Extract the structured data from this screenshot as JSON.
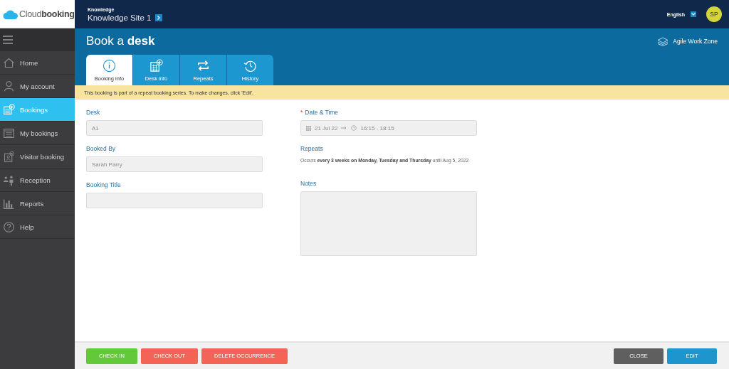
{
  "logo": {
    "light": "Cloud",
    "bold": "booking"
  },
  "header": {
    "site_label": "Knowledge",
    "site_name": "Knowledge Site 1",
    "language": "English",
    "avatar": "SP"
  },
  "sidebar": {
    "items": [
      {
        "label": "Home",
        "kind": "home",
        "selected": false
      },
      {
        "label": "My account",
        "kind": "account",
        "selected": false
      },
      {
        "label": "Bookings",
        "kind": "bookings",
        "selected": true
      },
      {
        "label": "My bookings",
        "kind": "list",
        "selected": false
      },
      {
        "label": "Visitor booking",
        "kind": "visitor",
        "selected": false
      },
      {
        "label": "Reception",
        "kind": "reception",
        "selected": false
      },
      {
        "label": "Reports",
        "kind": "reports",
        "selected": false
      },
      {
        "label": "Help",
        "kind": "help",
        "selected": false
      }
    ]
  },
  "page_title": "Book a **desk**",
  "zone": "Agile Work Zone",
  "tabs": [
    {
      "label": "Booking info",
      "kind": "info",
      "selected": true
    },
    {
      "label": "Desk info",
      "kind": "desk",
      "selected": false
    },
    {
      "label": "Repeats",
      "kind": "repeat",
      "selected": false
    },
    {
      "label": "History",
      "kind": "history",
      "selected": false
    }
  ],
  "banner": "This booking is part of a repeat booking series. To make changes, click 'Edit'.",
  "left_fields": [
    {
      "label": "Desk",
      "kind": "text",
      "value": "A1"
    },
    {
      "label": "Booked By",
      "kind": "text",
      "value": "Sarah Parry"
    },
    {
      "label": "Booking Title",
      "kind": "text"
    }
  ],
  "right_fields": [
    {
      "label": "Date & Time",
      "kind": "datetime",
      "marker": "*",
      "date": "21 Jul 22",
      "time": "16:15 - 18:15"
    },
    {
      "label": "Repeats",
      "kind": "info",
      "text": "Occurs **every 3 weeks on Monday, Tuesday and Thursday** until Aug 5, 2022"
    },
    {
      "label": "Notes",
      "kind": "notes"
    }
  ],
  "actions_left": [
    {
      "label": "CHECK IN",
      "kind": "success"
    },
    {
      "label": "CHECK OUT",
      "kind": "danger"
    },
    {
      "label": "DELETE OCCURRENCE",
      "kind": "danger"
    }
  ],
  "actions_right": [
    {
      "label": "CLOSE",
      "kind": "neutral"
    },
    {
      "label": "EDIT",
      "kind": "primary"
    }
  ]
}
